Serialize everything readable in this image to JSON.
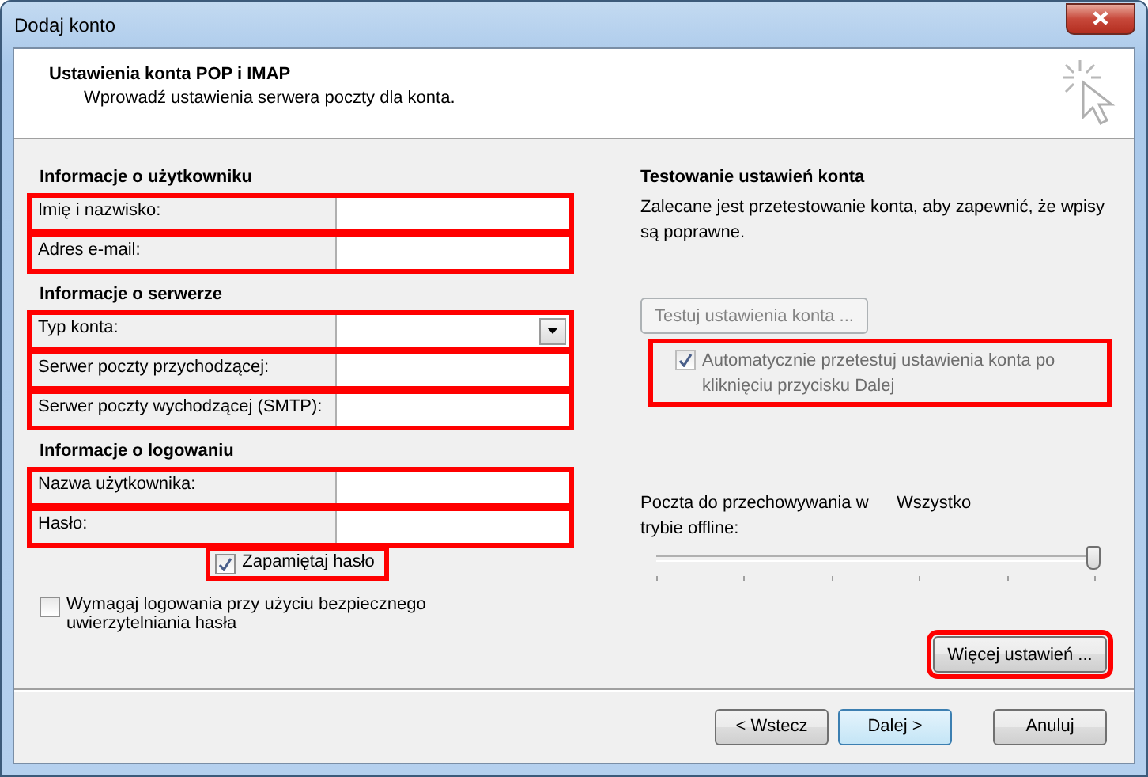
{
  "window": {
    "title": "Dodaj konto"
  },
  "header": {
    "title": "Ustawienia konta POP i IMAP",
    "subtitle": "Wprowadź ustawienia serwera poczty dla konta."
  },
  "sections": [
    {
      "heading": "Informacje o użytkowniku",
      "fields": [
        {
          "label": "Imię i nazwisko:",
          "kind": "text",
          "highlighted": true
        },
        {
          "label": "Adres e-mail:",
          "kind": "text",
          "highlighted": true
        }
      ]
    },
    {
      "heading": "Informacje o serwerze",
      "fields": [
        {
          "label": "Typ konta:",
          "kind": "dropdown",
          "highlighted": true
        },
        {
          "label": "Serwer poczty przychodzącej:",
          "kind": "text",
          "highlighted": true
        },
        {
          "label": "Serwer poczty wychodzącej (SMTP):",
          "kind": "text",
          "highlighted": true
        }
      ]
    },
    {
      "heading": "Informacje o logowaniu",
      "fields": [
        {
          "label": "Nazwa użytkownika:",
          "kind": "text",
          "highlighted": true
        },
        {
          "label": "Hasło:",
          "kind": "text",
          "highlighted": true
        }
      ]
    }
  ],
  "remember_password": {
    "label": "Zapamiętaj hasło",
    "checked": true,
    "highlighted": true
  },
  "secure_auth": {
    "label": "Wymagaj logowania przy użyciu bezpiecznego uwierzytelniania hasła",
    "checked": false,
    "highlighted": false
  },
  "test": {
    "heading": "Testowanie ustawień konta",
    "description": "Zalecane jest przetestowanie konta, aby zapewnić, że wpisy są poprawne.",
    "button": {
      "label": "Testuj ustawienia konta ...",
      "disabled": true
    },
    "auto_test": {
      "label": "Automatycznie przetestuj ustawienia konta po kliknięciu przycisku Dalej",
      "checked": true,
      "disabled": true,
      "highlighted": true
    }
  },
  "offline": {
    "label": "Poczta do przechowywania w trybie offline:",
    "value": "Wszystko",
    "level": 1
  },
  "more_settings": {
    "label": "Więcej ustawień ...",
    "highlighted": true
  },
  "buttons": [
    {
      "label": "< Wstecz",
      "default": false
    },
    {
      "label": "Dalej >",
      "default": true
    },
    {
      "label": "Anuluj",
      "default": false
    }
  ]
}
